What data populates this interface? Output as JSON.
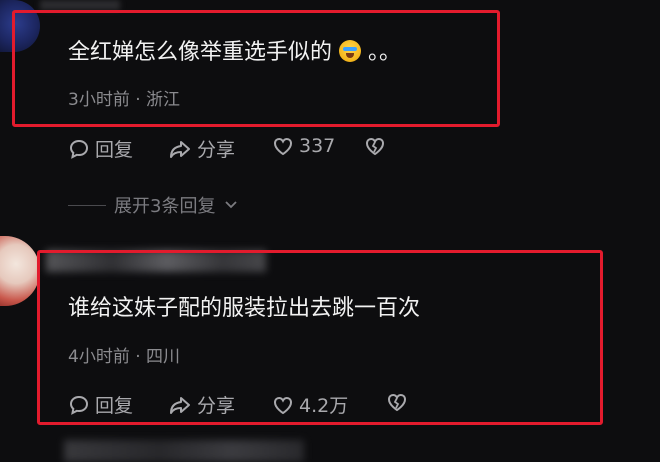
{
  "comments": [
    {
      "text": "全红婵怎么像举重选手似的",
      "suffix": "。。",
      "meta": "3小时前 · 浙江",
      "reply_label": "回复",
      "share_label": "分享",
      "likes": "337"
    },
    {
      "text": "谁给这妹子配的服装拉出去跳一百次",
      "meta": "4小时前 · 四川",
      "reply_label": "回复",
      "share_label": "分享",
      "likes": "4.2万"
    }
  ],
  "expand_replies": "展开3条回复",
  "colors": {
    "highlight": "#e21b2d",
    "background": "#0d0d0f"
  },
  "icons": [
    "comment-bubble-icon",
    "share-arrow-icon",
    "heart-icon",
    "broken-heart-icon",
    "chevron-down-icon",
    "laughing-crying-emoji-icon"
  ]
}
